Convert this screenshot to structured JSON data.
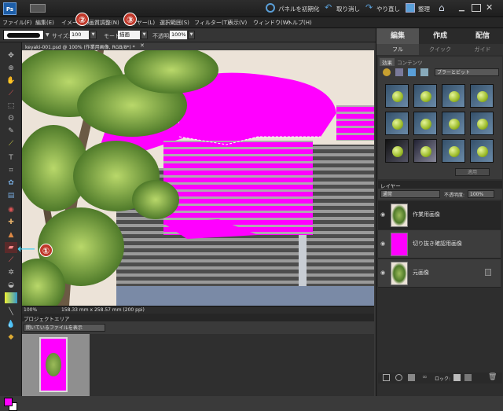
{
  "titlebar": {
    "reset_panels": "パネルを初期化",
    "undo": "取り消し",
    "redo": "やり直し",
    "organize": "整理"
  },
  "menu": [
    "ファイル(F)",
    "編集(E)",
    "イメージ(I)",
    "画質調整(N)",
    "レイヤー(L)",
    "選択範囲(S)",
    "フィルター(T)",
    "表示(V)",
    "ウィンドウ(W)",
    "ヘルプ(H)"
  ],
  "options": {
    "size_label": "サイズ:",
    "size_value": "100 px",
    "mode_label": "モード:",
    "mode_value": "描画",
    "opacity_label": "不透明度:",
    "opacity_value": "100%"
  },
  "document": {
    "tab_title": "keyaki-001.psd @ 100% (作業用画像, RGB/8*) *",
    "zoom": "100%",
    "dimensions": "158.33 mm x 258.57 mm (200 ppi)"
  },
  "project_bin": {
    "title": "プロジェクトエリア",
    "filter": "開いているファイルを表示"
  },
  "right_panel": {
    "mode_tabs": [
      "編集",
      "作成",
      "配信"
    ],
    "sub_tabs": [
      "フル",
      "クイック",
      "ガイド"
    ],
    "effects_tabs": [
      "効果",
      "コンテンツ"
    ],
    "effects_dropdown": "ブラーとビット",
    "apply_button": "適用",
    "layers_title": "レイヤー",
    "blend_mode": "通常",
    "opacity_label": "不透明度:",
    "opacity_value": "100%",
    "layers": [
      {
        "name": "作業用画像"
      },
      {
        "name": "切り抜き確認用画像"
      },
      {
        "name": "元画像"
      }
    ],
    "lock_label": "ロック:"
  },
  "callouts": [
    "①",
    "②",
    "③"
  ],
  "colors": {
    "foreground": "#ff00ff",
    "background": "#ffffff",
    "accent": "#ff00ff"
  },
  "icons": [
    "app-logo-icon",
    "mode-icon",
    "reset-panels-icon",
    "undo-icon",
    "redo-icon",
    "organize-icon",
    "home-icon",
    "minimize-icon",
    "maximize-icon",
    "close-icon"
  ]
}
